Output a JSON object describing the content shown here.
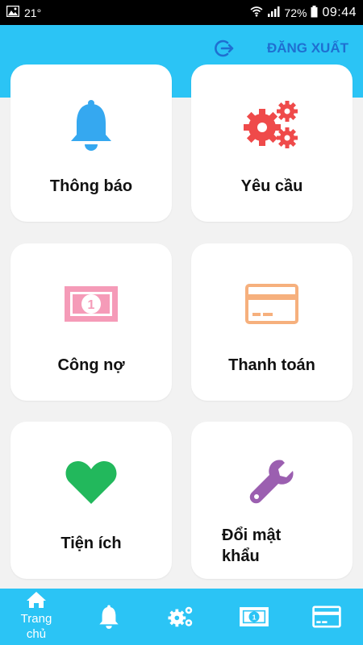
{
  "status_bar": {
    "temperature": "21°",
    "battery": "72%",
    "time": "09:44",
    "icons": [
      "image-icon",
      "wifi-icon",
      "signal-icon",
      "battery-icon"
    ]
  },
  "header": {
    "logout_label": "ĐĂNG XUẤT",
    "logout_icon": "logout-icon",
    "accent_color": "#2bc4f5",
    "logout_color": "#1f6fd1"
  },
  "cards": [
    {
      "label": "Thông báo",
      "icon": "bell-icon",
      "icon_color": "#35a8f0"
    },
    {
      "label": "Yêu cầu",
      "icon": "gears-icon",
      "icon_color": "#ef4a4a"
    },
    {
      "label": "Công nợ",
      "icon": "money-icon",
      "icon_color": "#f59bb8"
    },
    {
      "label": "Thanh toán",
      "icon": "credit-card-icon",
      "icon_color": "#f6b07d"
    },
    {
      "label": "Tiện ích",
      "icon": "heart-icon",
      "icon_color": "#22b85c"
    },
    {
      "label_lines": [
        "Đổi mật",
        "khẩu"
      ],
      "icon": "wrench-icon",
      "icon_color": "#9b5fb0"
    }
  ],
  "bottom_nav": [
    {
      "label_lines": [
        "Trang",
        "chủ"
      ],
      "icon": "home-icon",
      "active": true
    },
    {
      "icon": "bell-icon"
    },
    {
      "icon": "gears-icon"
    },
    {
      "icon": "money-icon"
    },
    {
      "icon": "credit-card-icon"
    }
  ]
}
